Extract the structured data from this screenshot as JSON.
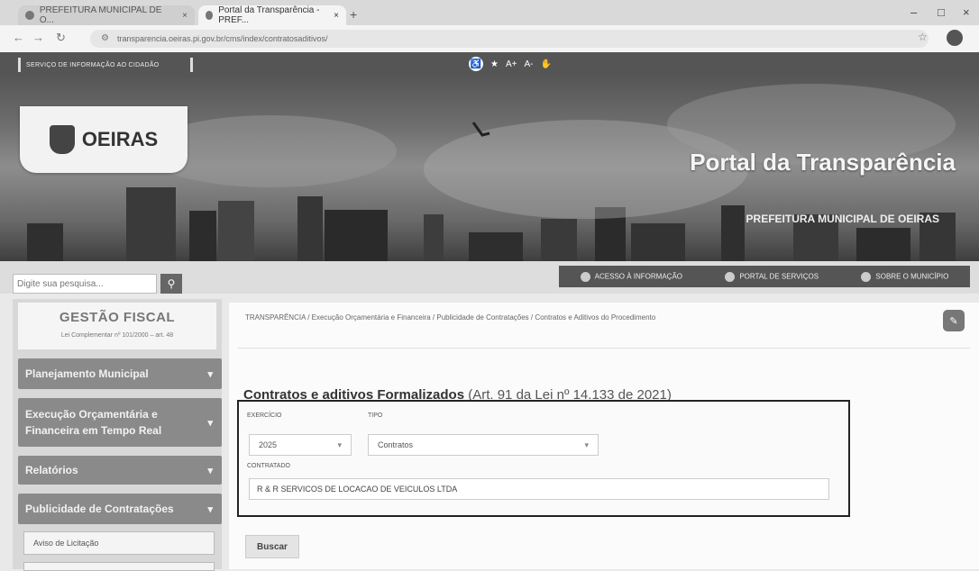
{
  "browser": {
    "tabs": [
      {
        "label": "PREFEITURA MUNICIPAL DE O..."
      },
      {
        "label": "Portal da Transparência - PREF..."
      }
    ],
    "new_tab": "+",
    "url": "transparencia.oeiras.pi.gov.br/cms/index/contratosaditivos/",
    "min": "–",
    "max": "□",
    "close": "×"
  },
  "header": {
    "sic_label": "SERVIÇO DE INFORMAÇÃO AO CIDADÃO",
    "access": {
      "font_plus": "A+",
      "font_minus": "A-"
    },
    "logo_text": "OEIRAS",
    "portal_title": "Portal da Transparência",
    "prefeitura": "PREFEITURA MUNICIPAL DE OEIRAS"
  },
  "search": {
    "placeholder": "Digite sua pesquisa..."
  },
  "top_links": [
    {
      "label": "ACESSO À INFORMAÇÃO"
    },
    {
      "label": "PORTAL DE SERVIÇOS"
    },
    {
      "label": "SOBRE O MUNICÍPIO"
    }
  ],
  "sidebar": {
    "gestao_title": "GESTÃO FISCAL",
    "gestao_sub": "Lei Complementar nº 101/2000 – art. 48",
    "menu": [
      {
        "label": "Planejamento Municipal"
      },
      {
        "label": "Execução Orçamentária e Financeira em Tempo Real"
      },
      {
        "label": "Relatórios"
      },
      {
        "label": "Publicidade de Contratações"
      }
    ],
    "submenu": [
      {
        "label": "Aviso de Licitação"
      }
    ]
  },
  "main": {
    "breadcrumb": "TRANSPARÊNCIA  /  Execução Orçamentária e Financeira  /  Publicidade de Contratações  /  Contratos e Aditivos do Procedimento",
    "title": "Contratos e aditivos Formalizados",
    "title_ref": "(Art. 91 da Lei nº 14.133 de 2021)",
    "filters": {
      "exercicio_label": "EXERCÍCIO",
      "exercicio_value": "2025",
      "tipo_label": "TIPO",
      "tipo_value": "Contratos",
      "contratado_label": "CONTRATADO",
      "contratado_value": "R & R SERVICOS DE LOCACAO DE VEICULOS LTDA"
    },
    "buscar": "Buscar"
  }
}
